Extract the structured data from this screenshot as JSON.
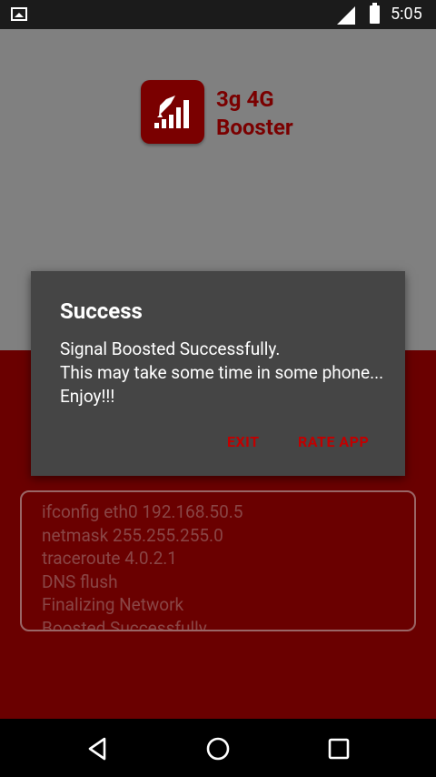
{
  "status_bar": {
    "time": "5:05"
  },
  "app": {
    "title_line1": "3g 4G",
    "title_line2": "Booster",
    "log_lines": [
      "ifconfig eth0 192.168.50.5",
      "netmask 255.255.255.0",
      "traceroute 4.0.2.1",
      "DNS flush",
      "Finalizing Network",
      "Boosted Successfully"
    ]
  },
  "dialog": {
    "title": "Success",
    "message": "Signal Boosted Successfully.\nThis may take some time in some phone... Enjoy!!!",
    "exit_label": "EXIT",
    "rate_label": "RATE APP"
  },
  "colors": {
    "accent": "#c10000",
    "dark_red": "#6a0000",
    "dialog_bg": "#454545"
  }
}
